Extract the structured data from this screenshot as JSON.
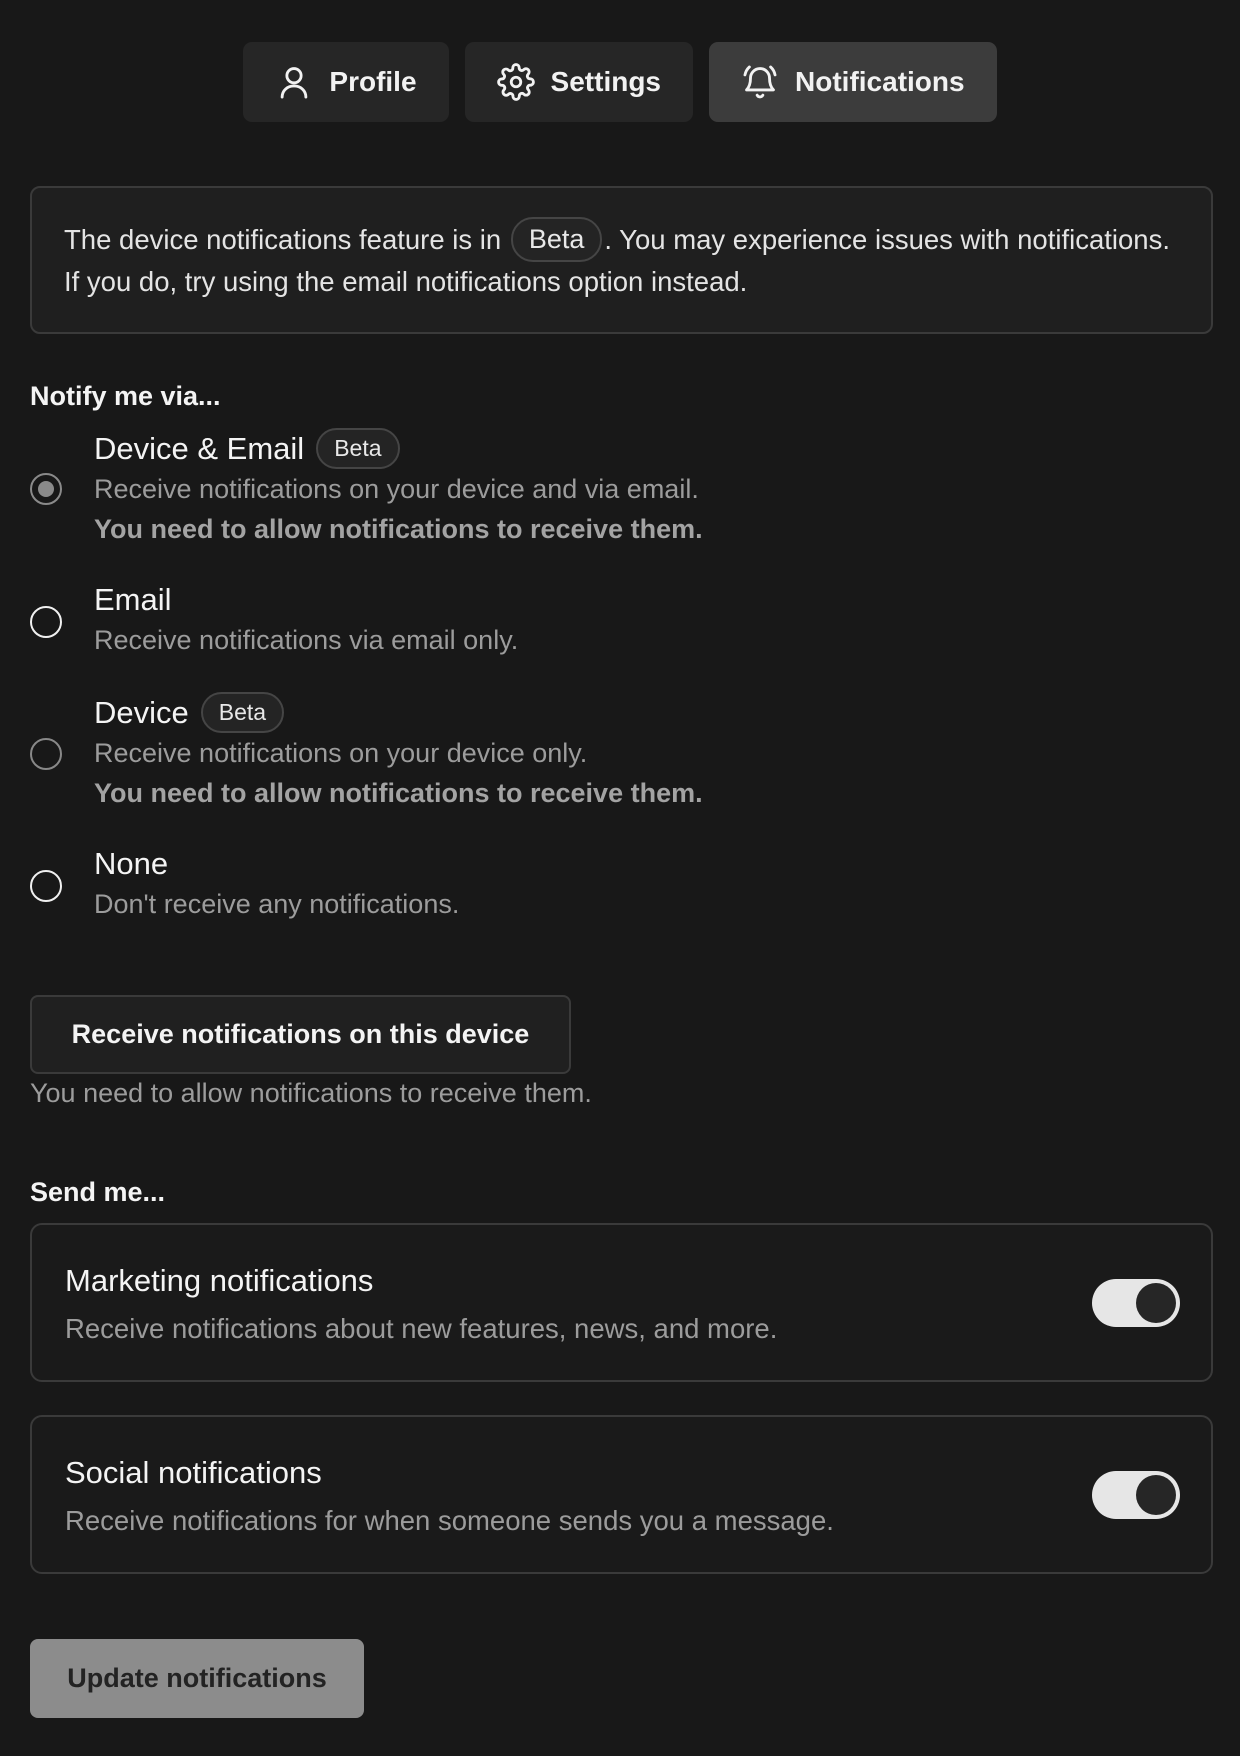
{
  "tabs": [
    {
      "label": "Profile",
      "icon": "user-icon",
      "active": false
    },
    {
      "label": "Settings",
      "icon": "gear-icon",
      "active": false
    },
    {
      "label": "Notifications",
      "icon": "bell-icon",
      "active": true
    }
  ],
  "alert": {
    "text_before": "The device notifications feature is in ",
    "badge": "Beta",
    "text_after": ". You may experience issues with notifications. If you do, try using the email notifications option instead."
  },
  "notify_section": {
    "label": "Notify me via...",
    "options": [
      {
        "title": "Device & Email",
        "badge": "Beta",
        "description": "Receive notifications on your device and via email.",
        "note": "You need to allow notifications to receive them.",
        "checked": true
      },
      {
        "title": "Email",
        "badge": "",
        "description": "Receive notifications via email only.",
        "note": "",
        "checked": false
      },
      {
        "title": "Device",
        "badge": "Beta",
        "description": "Receive notifications on your device only.",
        "note": "You need to allow notifications to receive them.",
        "checked": false
      },
      {
        "title": "None",
        "badge": "",
        "description": "Don't receive any notifications.",
        "note": "",
        "checked": false
      }
    ]
  },
  "device_button": {
    "label": "Receive notifications on this device",
    "help": "You need to allow notifications to receive them."
  },
  "send_section": {
    "label": "Send me...",
    "cards": [
      {
        "title": "Marketing notifications",
        "description": "Receive notifications about new features, news, and more.",
        "enabled": true
      },
      {
        "title": "Social notifications",
        "description": "Receive notifications for when someone sends you a message.",
        "enabled": true
      }
    ]
  },
  "submit": {
    "label": "Update notifications"
  },
  "colors": {
    "background": "#181818",
    "surface": "#262626",
    "active_tab": "#3c3c3c",
    "muted_text": "#9c9c9c",
    "submit_bg": "#8c8c8c"
  }
}
